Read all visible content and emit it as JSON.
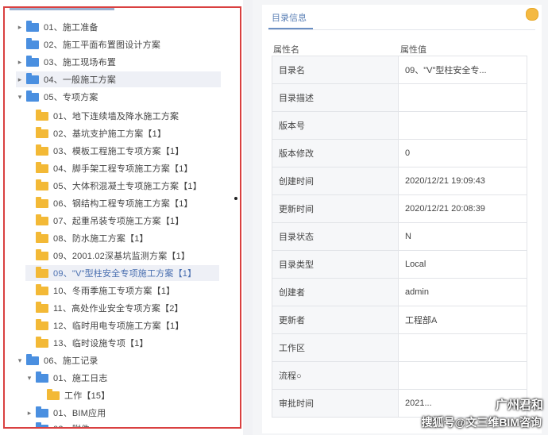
{
  "tree": {
    "items": [
      {
        "label": "01、施工准备",
        "caret": "▸",
        "color": "blue"
      },
      {
        "label": "02、施工平面布置图设计方案",
        "caret": "",
        "color": "blue"
      },
      {
        "label": "03、施工现场布置",
        "caret": "▸",
        "color": "blue"
      },
      {
        "label": "04、一般施工方案",
        "caret": "▸",
        "color": "blue"
      },
      {
        "label": "05、专项方案",
        "caret": "▾",
        "color": "blue"
      },
      {
        "label": "01、地下连续墙及降水施工方案",
        "caret": "",
        "color": "yellow"
      },
      {
        "label": "02、基坑支护施工方案【1】",
        "caret": "",
        "color": "yellow"
      },
      {
        "label": "03、模板工程施工专项方案【1】",
        "caret": "",
        "color": "yellow"
      },
      {
        "label": "04、脚手架工程专项施工方案【1】",
        "caret": "",
        "color": "yellow"
      },
      {
        "label": "05、大体积混凝土专项施工方案【1】",
        "caret": "",
        "color": "yellow"
      },
      {
        "label": "06、钢结构工程专项施工方案【1】",
        "caret": "",
        "color": "yellow"
      },
      {
        "label": "07、起重吊装专项施工方案【1】",
        "caret": "",
        "color": "yellow"
      },
      {
        "label": "08、防水施工方案【1】",
        "caret": "",
        "color": "yellow"
      },
      {
        "label": "09、2001.02深基坑监测方案【1】",
        "caret": "",
        "color": "yellow"
      },
      {
        "label": "09、\"V\"型柱安全专项施工方案【1】",
        "caret": "",
        "color": "yellow"
      },
      {
        "label": "10、冬雨季施工专项方案【1】",
        "caret": "",
        "color": "yellow"
      },
      {
        "label": "11、高处作业安全专项方案【2】",
        "caret": "",
        "color": "yellow"
      },
      {
        "label": "12、临时用电专项施工方案【1】",
        "caret": "",
        "color": "yellow"
      },
      {
        "label": "13、临时设施专项【1】",
        "caret": "",
        "color": "yellow"
      },
      {
        "label": "06、施工记录",
        "caret": "▾",
        "color": "blue"
      },
      {
        "label": "01、施工日志",
        "caret": "▾",
        "color": "blue"
      },
      {
        "label": "工作【15】",
        "caret": "",
        "color": "yellow"
      },
      {
        "label": "01、BIM应用",
        "caret": "▸",
        "color": "blue"
      },
      {
        "label": "02、附件",
        "caret": "▸",
        "color": "blue"
      }
    ]
  },
  "props": {
    "tab_label": "目录信息",
    "header_key": "属性名",
    "header_val": "属性值",
    "rows": [
      {
        "key": "目录名",
        "val": "09、\"V\"型柱安全专..."
      },
      {
        "key": "目录描述",
        "val": ""
      },
      {
        "key": "版本号",
        "val": ""
      },
      {
        "key": "版本修改",
        "val": "0"
      },
      {
        "key": "创建时间",
        "val": "2020/12/21 19:09:43"
      },
      {
        "key": "更新时间",
        "val": "2020/12/21 20:08:39"
      },
      {
        "key": "目录状态",
        "val": "N"
      },
      {
        "key": "目录类型",
        "val": "Local"
      },
      {
        "key": "创建者",
        "val": "admin"
      },
      {
        "key": "更新者",
        "val": "工程部A"
      },
      {
        "key": "工作区",
        "val": ""
      },
      {
        "key": "流程○",
        "val": ""
      },
      {
        "key": "审批时间",
        "val": "2021..."
      }
    ]
  },
  "watermark": {
    "line1": "广州君和",
    "line2": "搜狐号@文三维BIM咨询"
  },
  "colors": {
    "tree_border": "#d94040",
    "folder_blue": "#4a8fe0",
    "folder_yellow": "#f3b936",
    "accent": "#5a7fb5"
  }
}
